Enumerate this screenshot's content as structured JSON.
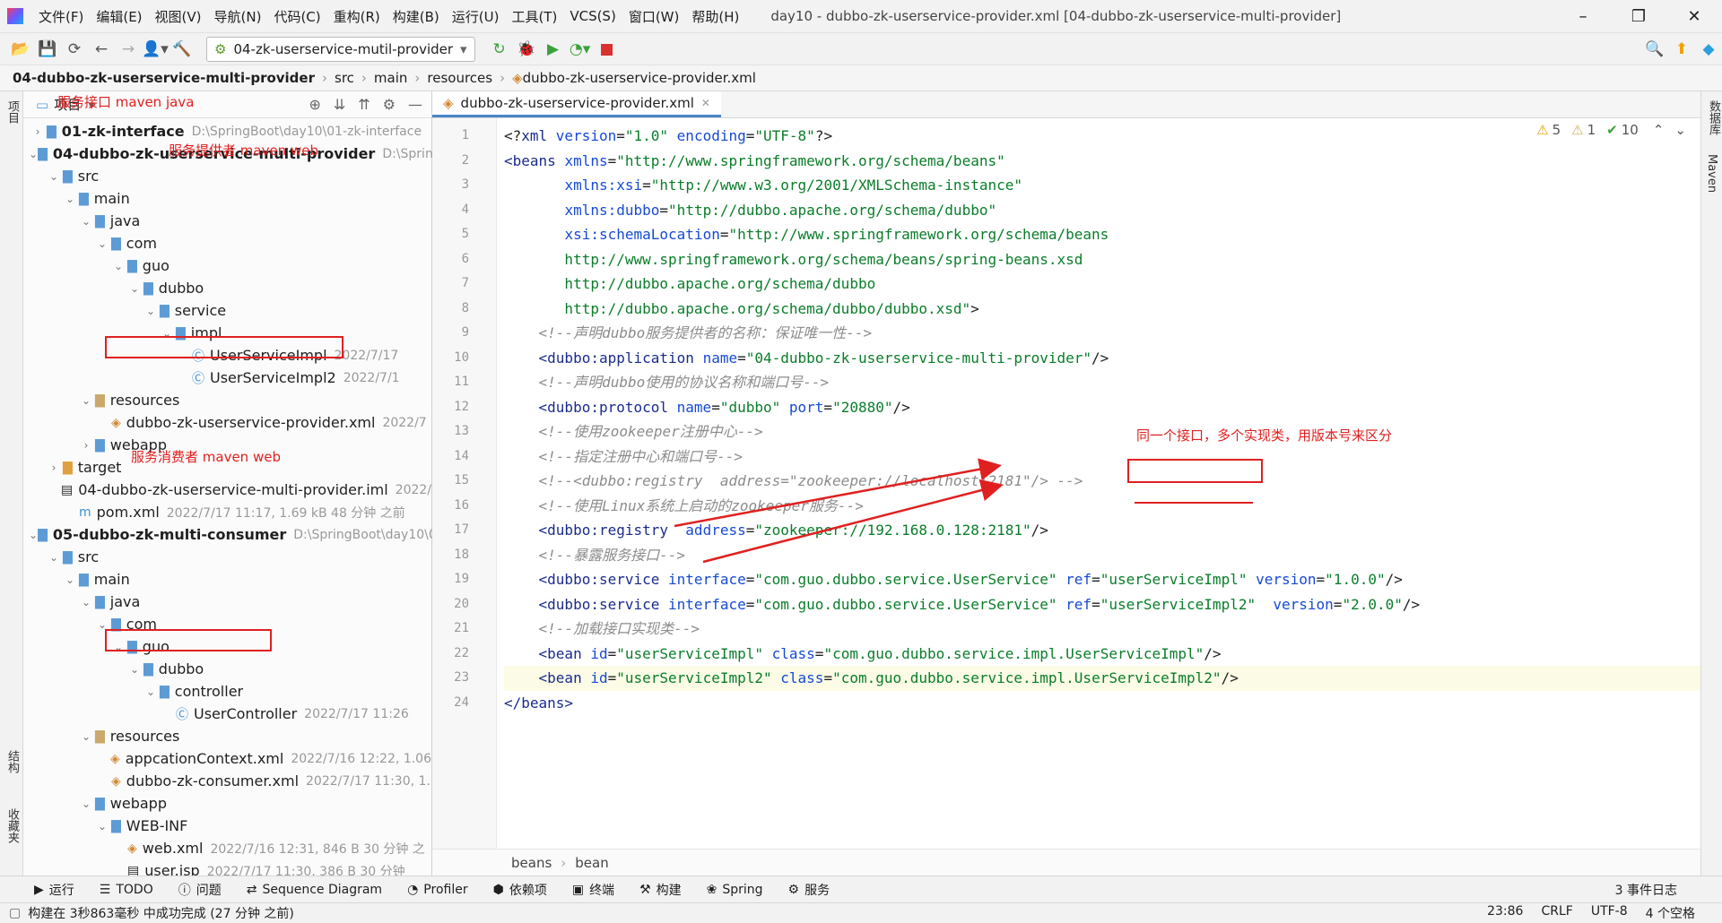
{
  "menu": {
    "items": [
      "文件(F)",
      "编辑(E)",
      "视图(V)",
      "导航(N)",
      "代码(C)",
      "重构(R)",
      "构建(B)",
      "运行(U)",
      "工具(T)",
      "VCS(S)",
      "窗口(W)",
      "帮助(H)"
    ],
    "window_title": "day10 - dubbo-zk-userservice-provider.xml [04-dubbo-zk-userservice-multi-provider]"
  },
  "toolbar": {
    "run_config": "04-zk-userservice-mutil-provider"
  },
  "breadcrumb": [
    "04-dubbo-zk-userservice-multi-provider",
    "src",
    "main",
    "resources",
    "dubbo-zk-userservice-provider.xml"
  ],
  "left_strip": {
    "project": "项目",
    "structure": "结构",
    "favorites": "收藏夹"
  },
  "right_strip": {
    "database": "数据库",
    "maven": "Maven"
  },
  "project": {
    "header": "项目",
    "tree": [
      {
        "label": "01-zk-interface",
        "path": "D:\\SpringBoot\\day10\\01-zk-interface",
        "bold": true,
        "arrow": "›",
        "icon": "fold",
        "indent": 0
      },
      {
        "label": "04-dubbo-zk-userservice-multi-provider",
        "path": "D:\\SpringBc",
        "bold": true,
        "arrow": "⌄",
        "icon": "fold",
        "indent": 0
      },
      {
        "label": "src",
        "arrow": "⌄",
        "icon": "fold",
        "indent": 1
      },
      {
        "label": "main",
        "arrow": "⌄",
        "icon": "fold",
        "indent": 2
      },
      {
        "label": "java",
        "arrow": "⌄",
        "icon": "fold",
        "indent": 3
      },
      {
        "label": "com",
        "arrow": "⌄",
        "icon": "fold",
        "indent": 4
      },
      {
        "label": "guo",
        "arrow": "⌄",
        "icon": "fold",
        "indent": 5
      },
      {
        "label": "dubbo",
        "arrow": "⌄",
        "icon": "fold",
        "indent": 6
      },
      {
        "label": "service",
        "arrow": "⌄",
        "icon": "fold",
        "indent": 7
      },
      {
        "label": "impl",
        "arrow": "⌄",
        "icon": "fold",
        "indent": 8
      },
      {
        "label": "UserServiceImpl",
        "meta": "2022/7/17",
        "icon": "cls",
        "indent": 9
      },
      {
        "label": "UserServiceImpl2",
        "meta": "2022/7/1",
        "icon": "cls",
        "indent": 9
      },
      {
        "label": "resources",
        "arrow": "⌄",
        "icon": "fold-r",
        "indent": 3
      },
      {
        "label": "dubbo-zk-userservice-provider.xml",
        "meta": "2022/7",
        "icon": "xml",
        "indent": 4
      },
      {
        "label": "webapp",
        "arrow": "›",
        "icon": "fold",
        "indent": 3
      },
      {
        "label": "target",
        "arrow": "›",
        "icon": "fold-o",
        "indent": 1
      },
      {
        "label": "04-dubbo-zk-userservice-multi-provider.iml",
        "meta": "2022/7/",
        "icon": "file",
        "indent": 2
      },
      {
        "label": "pom.xml",
        "meta": "2022/7/17 11:17, 1.69 kB 48 分钟 之前",
        "icon": "m",
        "indent": 2
      },
      {
        "label": "05-dubbo-zk-multi-consumer",
        "path": "D:\\SpringBoot\\day10\\0",
        "bold": true,
        "arrow": "⌄",
        "icon": "fold",
        "indent": 0
      },
      {
        "label": "src",
        "arrow": "⌄",
        "icon": "fold",
        "indent": 1
      },
      {
        "label": "main",
        "arrow": "⌄",
        "icon": "fold",
        "indent": 2
      },
      {
        "label": "java",
        "arrow": "⌄",
        "icon": "fold",
        "indent": 3
      },
      {
        "label": "com",
        "arrow": "⌄",
        "icon": "fold",
        "indent": 4
      },
      {
        "label": "guo",
        "arrow": "⌄",
        "icon": "fold",
        "indent": 5
      },
      {
        "label": "dubbo",
        "arrow": "⌄",
        "icon": "fold",
        "indent": 6
      },
      {
        "label": "controller",
        "arrow": "⌄",
        "icon": "fold",
        "indent": 7
      },
      {
        "label": "UserController",
        "meta": "2022/7/17 11:26",
        "icon": "cls",
        "indent": 8
      },
      {
        "label": "resources",
        "arrow": "⌄",
        "icon": "fold-r",
        "indent": 3
      },
      {
        "label": "appcationContext.xml",
        "meta": "2022/7/16 12:22, 1.06",
        "icon": "xml",
        "indent": 4
      },
      {
        "label": "dubbo-zk-consumer.xml",
        "meta": "2022/7/17 11:30, 1.",
        "icon": "xml",
        "indent": 4
      },
      {
        "label": "webapp",
        "arrow": "⌄",
        "icon": "fold",
        "indent": 3
      },
      {
        "label": "WEB-INF",
        "arrow": "⌄",
        "icon": "fold",
        "indent": 4
      },
      {
        "label": "web.xml",
        "meta": "2022/7/16 12:31, 846 B 30 分钟 之",
        "icon": "xml",
        "indent": 5
      },
      {
        "label": "user.jsp",
        "meta": "2022/7/17 11:30, 386 B 30 分钟",
        "icon": "file",
        "indent": 5
      }
    ],
    "annotations": {
      "interface": "服务接口 maven java",
      "provider": "服务提供者 maven web",
      "consumer": "服务消费者 maven web"
    }
  },
  "editor": {
    "tab": "dubbo-zk-userservice-provider.xml",
    "inspections": {
      "warnings": "5",
      "weak": "1",
      "ok": "10"
    },
    "code_annotation": "同一个接口，多个实现类，用版本号来区分",
    "lines": [
      [
        [
          "p",
          "<?"
        ],
        [
          "t",
          "xml "
        ],
        [
          "a",
          "version"
        ],
        [
          "p",
          "="
        ],
        [
          "v",
          "\"1.0\" "
        ],
        [
          "a",
          "encoding"
        ],
        [
          "p",
          "="
        ],
        [
          "v",
          "\"UTF-8\""
        ],
        [
          "p",
          "?>"
        ]
      ],
      [
        [
          "t",
          "<beans "
        ],
        [
          "a",
          "xmlns"
        ],
        [
          "p",
          "="
        ],
        [
          "v",
          "\"http://www.springframework.org/schema/beans\""
        ]
      ],
      [
        [
          "p",
          "       "
        ],
        [
          "a",
          "xmlns:xsi"
        ],
        [
          "p",
          "="
        ],
        [
          "v",
          "\"http://www.w3.org/2001/XMLSchema-instance\""
        ]
      ],
      [
        [
          "p",
          "       "
        ],
        [
          "a",
          "xmlns:dubbo"
        ],
        [
          "p",
          "="
        ],
        [
          "v",
          "\"http://dubbo.apache.org/schema/dubbo\""
        ]
      ],
      [
        [
          "p",
          "       "
        ],
        [
          "a",
          "xsi:schemaLocation"
        ],
        [
          "p",
          "="
        ],
        [
          "v",
          "\"http://www.springframework.org/schema/beans"
        ]
      ],
      [
        [
          "v",
          "       http://www.springframework.org/schema/beans/spring-beans.xsd"
        ]
      ],
      [
        [
          "v",
          "       http://dubbo.apache.org/schema/dubbo"
        ]
      ],
      [
        [
          "v",
          "       http://dubbo.apache.org/schema/dubbo/dubbo.xsd\""
        ],
        [
          "p",
          ">"
        ]
      ],
      [
        [
          "c",
          "    <!--声明dubbo服务提供者的名称：保证唯一性-->"
        ]
      ],
      [
        [
          "t",
          "    <dubbo:application "
        ],
        [
          "a",
          "name"
        ],
        [
          "p",
          "="
        ],
        [
          "v",
          "\"04-dubbo-zk-userservice-multi-provider\""
        ],
        [
          "p",
          "/>"
        ]
      ],
      [
        [
          "c",
          "    <!--声明dubbo使用的协议名称和端口号-->"
        ]
      ],
      [
        [
          "t",
          "    <dubbo:protocol "
        ],
        [
          "a",
          "name"
        ],
        [
          "p",
          "="
        ],
        [
          "v",
          "\"dubbo\" "
        ],
        [
          "a",
          "port"
        ],
        [
          "p",
          "="
        ],
        [
          "v",
          "\"20880\""
        ],
        [
          "p",
          "/>"
        ]
      ],
      [
        [
          "c",
          "    <!--使用zookeeper注册中心-->"
        ]
      ],
      [
        [
          "c",
          "    <!--指定注册中心和端口号-->"
        ]
      ],
      [
        [
          "c",
          "    <!--<dubbo:registry  address=\"zookeeper://localhost:2181\"/> -->"
        ]
      ],
      [
        [
          "c",
          "    <!--使用Linux系统上启动的zookeeper服务-->"
        ]
      ],
      [
        [
          "t",
          "    <dubbo:registry  "
        ],
        [
          "a",
          "address"
        ],
        [
          "p",
          "="
        ],
        [
          "v",
          "\"zookeeper://192.168.0.128:2181\""
        ],
        [
          "p",
          "/>"
        ]
      ],
      [
        [
          "c",
          "    <!--暴露服务接口-->"
        ]
      ],
      [
        [
          "t",
          "    <dubbo:service "
        ],
        [
          "a",
          "interface"
        ],
        [
          "p",
          "="
        ],
        [
          "v",
          "\"com.guo.dubbo.service.UserService\" "
        ],
        [
          "a",
          "ref"
        ],
        [
          "p",
          "="
        ],
        [
          "v",
          "\"userServiceImpl\" "
        ],
        [
          "a",
          "version"
        ],
        [
          "p",
          "="
        ],
        [
          "v",
          "\"1.0.0\""
        ],
        [
          "p",
          "/>"
        ]
      ],
      [
        [
          "t",
          "    <dubbo:service "
        ],
        [
          "a",
          "interface"
        ],
        [
          "p",
          "="
        ],
        [
          "v",
          "\"com.guo.dubbo.service.UserService\" "
        ],
        [
          "a",
          "ref"
        ],
        [
          "p",
          "="
        ],
        [
          "v",
          "\"userServiceImpl2\"  "
        ],
        [
          "a",
          "version"
        ],
        [
          "p",
          "="
        ],
        [
          "v",
          "\"2.0.0\""
        ],
        [
          "p",
          "/>"
        ]
      ],
      [
        [
          "c",
          "    <!--加载接口实现类-->"
        ]
      ],
      [
        [
          "t",
          "    <bean "
        ],
        [
          "a",
          "id"
        ],
        [
          "p",
          "="
        ],
        [
          "v",
          "\"userServiceImpl\" "
        ],
        [
          "a",
          "class"
        ],
        [
          "p",
          "="
        ],
        [
          "v",
          "\"com.guo.dubbo.service.impl.UserServiceImpl\""
        ],
        [
          "p",
          "/>"
        ]
      ],
      [
        [
          "t",
          "    <bean "
        ],
        [
          "a",
          "id"
        ],
        [
          "p",
          "="
        ],
        [
          "v",
          "\"userServiceImpl2\" "
        ],
        [
          "a",
          "class"
        ],
        [
          "p",
          "="
        ],
        [
          "v",
          "\"com.guo.dubbo.service.impl.UserServiceImpl2\""
        ],
        [
          "p",
          "/>"
        ]
      ],
      [
        [
          "t",
          "</beans>"
        ]
      ]
    ],
    "crumb": [
      "beans",
      "bean"
    ]
  },
  "toolwindows": [
    "运行",
    "TODO",
    "问题",
    "Sequence Diagram",
    "Profiler",
    "依赖项",
    "终端",
    "构建",
    "Spring",
    "服务"
  ],
  "event_log": "3 事件日志",
  "status": {
    "message": "构建在 3秒863毫秒 中成功完成 (27 分钟 之前)",
    "position": "23:86",
    "line_sep": "CRLF",
    "encoding": "UTF-8",
    "indent": "4 个空格"
  }
}
